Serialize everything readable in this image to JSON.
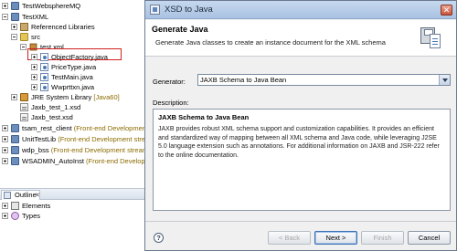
{
  "explorer": {
    "rows": [
      {
        "label": "TestWebsphereMQ",
        "decoration": ""
      },
      {
        "label": "TestXML",
        "decoration": ""
      },
      {
        "label": "Referenced Libraries",
        "decoration": ""
      },
      {
        "label": "src",
        "decoration": ""
      },
      {
        "label": "test.xml",
        "decoration": ""
      },
      {
        "label": "ObjectFactory.java",
        "decoration": ""
      },
      {
        "label": "PriceType.java",
        "decoration": ""
      },
      {
        "label": "TestMain.java",
        "decoration": ""
      },
      {
        "label": "Wwprttxn.java",
        "decoration": ""
      },
      {
        "label": "JRE System Library",
        "decoration": "[Java60]"
      },
      {
        "label": "Jaxb_test_1.xsd",
        "decoration": ""
      },
      {
        "label": "Jaxb_test.xsd",
        "decoration": ""
      },
      {
        "label": "tsam_rest_client",
        "decoration": "(Front-end Development"
      },
      {
        "label": "UnitTestLib",
        "decoration": "(Front-end Development stre"
      },
      {
        "label": "wdp_bss",
        "decoration": "(Front-end Development stream"
      },
      {
        "label": "WSADMIN_AutoInst",
        "decoration": "(Front-end Development"
      }
    ]
  },
  "outline": {
    "tab_label": "Outline",
    "close_glyph": "✕",
    "items": [
      {
        "label": "Elements"
      },
      {
        "label": "Types"
      }
    ]
  },
  "dialog": {
    "title": "XSD to Java",
    "close_glyph": "✕",
    "banner_title": "Generate Java",
    "banner_description": "Generate Java classes to create an instance document for the XML schema",
    "generator_label": "Generator:",
    "generator_value": "JAXB Schema to Java Bean",
    "description_label": "Description:",
    "description_heading": "JAXB Schema to Java Bean",
    "description_body": "JAXB provides robust XML schema support and customization capabilities. It provides an efficient and standardized way of mapping between all XML schema and Java code, while leveraging J2SE 5.0 language extension such as annotations. For additional information on JAXB and JSR-222 refer to the online documentation.",
    "help_glyph": "?",
    "buttons": {
      "back": "< Back",
      "next": "Next >",
      "finish": "Finish",
      "cancel": "Cancel"
    }
  },
  "colors": {
    "highlight_box": "#d22020",
    "decoration_text": "#8b6b00",
    "title_bar": "#a9c2e2"
  }
}
